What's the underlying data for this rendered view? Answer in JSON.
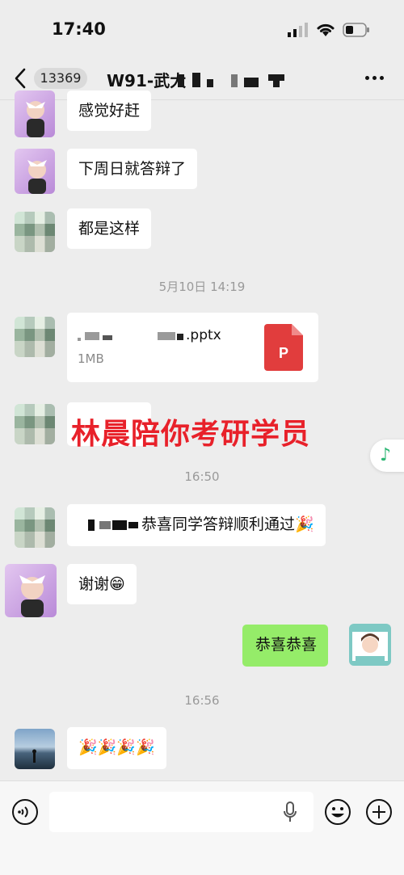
{
  "status_bar": {
    "time": "17:40"
  },
  "nav": {
    "unread_count": "13369",
    "title": "W91-武大"
  },
  "messages": [
    {
      "text": "感觉好赶"
    },
    {
      "text": "下周日就答辩了"
    },
    {
      "text": "都是这样"
    },
    {
      "timestamp": "5月10日 14:19"
    },
    {
      "file_name": ".pptx",
      "file_size": "1MB",
      "file_icon_letter": "P"
    },
    {
      "overlay_text": "林晨陪你考研学员"
    },
    {
      "timestamp": "16:50"
    },
    {
      "text": "恭喜同学答辩顺利通过🎉"
    },
    {
      "text": "谢谢😁"
    },
    {
      "text": "恭喜恭喜"
    },
    {
      "timestamp": "16:56"
    },
    {
      "text": "🎉🎉🎉🎉"
    }
  ],
  "icons": {
    "back": "chevron-left-icon",
    "more": "more-dots-icon",
    "music": "music-note-icon",
    "voice": "voice-icon",
    "mic": "microphone-icon",
    "emoji": "emoji-icon",
    "plus": "plus-icon",
    "ppt": "ppt-file-icon"
  },
  "colors": {
    "my_bubble": "#95ec69",
    "overlay_text": "#e8212a",
    "ppt_icon": "#e13d3d",
    "background": "#ededed"
  }
}
